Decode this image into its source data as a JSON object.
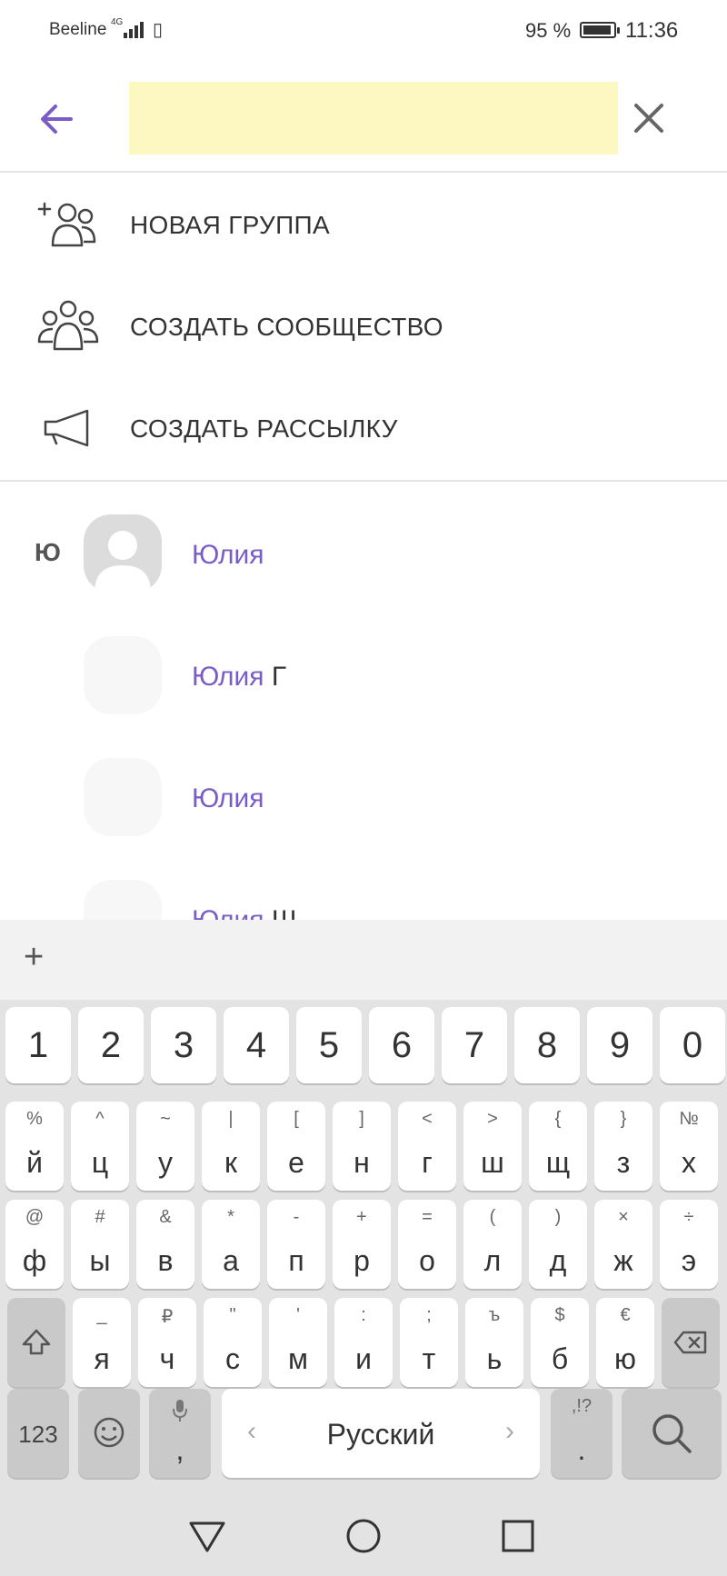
{
  "status_bar": {
    "carrier": "Beeline",
    "network": "4G",
    "battery_percent": "95 %",
    "battery_level": 0.95,
    "time": "11:36"
  },
  "header": {
    "back_icon": "arrow-left-icon",
    "search_value": "",
    "clear_icon": "close-icon"
  },
  "actions": [
    {
      "icon": "add-group-icon",
      "label": "НОВАЯ ГРУППА"
    },
    {
      "icon": "community-icon",
      "label": "СОЗДАТЬ СООБЩЕСТВО"
    },
    {
      "icon": "megaphone-icon",
      "label": "СОЗДАТЬ РАССЫЛКУ"
    }
  ],
  "contacts": {
    "section_letter": "Ю",
    "items": [
      {
        "first": "Юлия",
        "last": ""
      },
      {
        "first": "Юлия",
        "last": "Г"
      },
      {
        "first": "Юлия",
        "last": ""
      },
      {
        "first": "Юлия",
        "last": "Ш"
      }
    ]
  },
  "keyboard": {
    "toolbar_plus": "+",
    "numbers": [
      "1",
      "2",
      "3",
      "4",
      "5",
      "6",
      "7",
      "8",
      "9",
      "0"
    ],
    "row1": [
      {
        "sub": "%",
        "main": "й"
      },
      {
        "sub": "^",
        "main": "ц"
      },
      {
        "sub": "~",
        "main": "у"
      },
      {
        "sub": "|",
        "main": "к"
      },
      {
        "sub": "[",
        "main": "е"
      },
      {
        "sub": "]",
        "main": "н"
      },
      {
        "sub": "<",
        "main": "г"
      },
      {
        "sub": ">",
        "main": "ш"
      },
      {
        "sub": "{",
        "main": "щ"
      },
      {
        "sub": "}",
        "main": "з"
      },
      {
        "sub": "№",
        "main": "х"
      }
    ],
    "row2": [
      {
        "sub": "@",
        "main": "ф"
      },
      {
        "sub": "#",
        "main": "ы"
      },
      {
        "sub": "&",
        "main": "в"
      },
      {
        "sub": "*",
        "main": "а"
      },
      {
        "sub": "-",
        "main": "п"
      },
      {
        "sub": "+",
        "main": "р"
      },
      {
        "sub": "=",
        "main": "о"
      },
      {
        "sub": "(",
        "main": "л"
      },
      {
        "sub": ")",
        "main": "д"
      },
      {
        "sub": "×",
        "main": "ж"
      },
      {
        "sub": "÷",
        "main": "э"
      }
    ],
    "row3": [
      {
        "sub": "_",
        "main": "я"
      },
      {
        "sub": "₽",
        "main": "ч"
      },
      {
        "sub": "\"",
        "main": "с"
      },
      {
        "sub": "'",
        "main": "м"
      },
      {
        "sub": ":",
        "main": "и"
      },
      {
        "sub": ";",
        "main": "т"
      },
      {
        "sub": "ъ",
        "main": "ь"
      },
      {
        "sub": "$",
        "main": "б"
      },
      {
        "sub": "€",
        "main": "ю"
      }
    ],
    "numeric_toggle": "123",
    "comma_sub": "🎤",
    "comma": ",",
    "space_label": "Русский",
    "space_left": "‹",
    "space_right": "›",
    "period_sub": ",!?",
    "period": "."
  },
  "navbar": {
    "back_icon": "triangle-back-icon",
    "home_icon": "circle-home-icon",
    "recents_icon": "square-recents-icon"
  }
}
